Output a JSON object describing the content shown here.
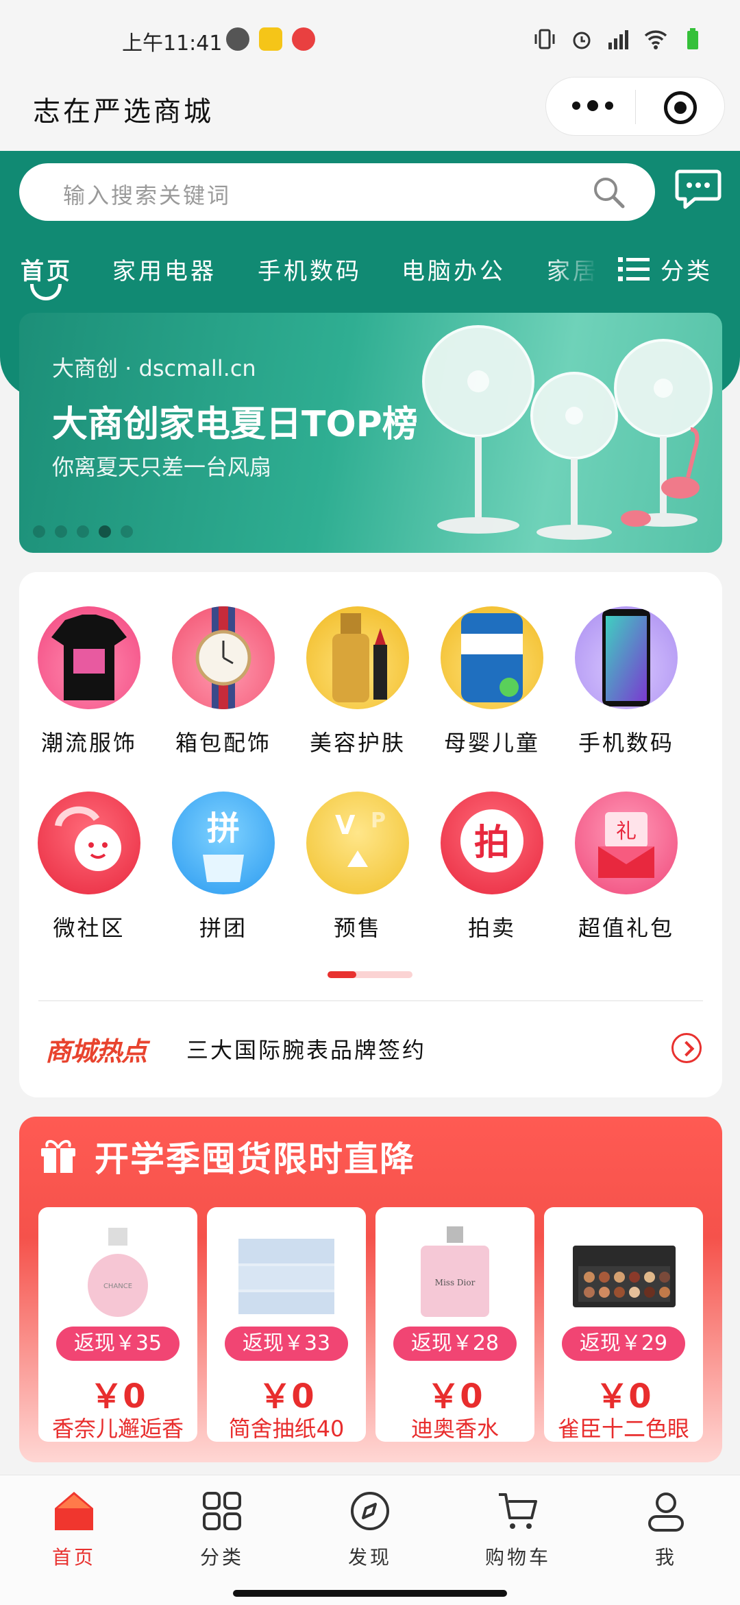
{
  "status_bar": {
    "time": "上午11:41"
  },
  "header": {
    "title": "志在严选商城"
  },
  "search": {
    "placeholder": "输入搜索关键词"
  },
  "nav_tabs": [
    "首页",
    "家用电器",
    "手机数码",
    "电脑办公",
    "家居"
  ],
  "category_button": "分类",
  "banner": {
    "brand": "大商创 · dscmall.cn",
    "title": "大商创家电夏日TOP榜",
    "subtitle": "你离夏天只差一台风扇",
    "active_slide": 4,
    "slide_count": 5
  },
  "categories": [
    {
      "label": "潮流服饰",
      "icon": "tshirt-icon"
    },
    {
      "label": "箱包配饰",
      "icon": "watch-icon"
    },
    {
      "label": "美容护肤",
      "icon": "cosmetics-icon"
    },
    {
      "label": "母婴儿童",
      "icon": "milk-powder-icon"
    },
    {
      "label": "手机数码",
      "icon": "phone-icon"
    },
    {
      "label": "微社区",
      "icon": "chat-icon"
    },
    {
      "label": "拼团",
      "icon": "group-buy-icon"
    },
    {
      "label": "预售",
      "icon": "presale-icon"
    },
    {
      "label": "拍卖",
      "icon": "auction-icon"
    },
    {
      "label": "超值礼包",
      "icon": "gift-pack-icon"
    }
  ],
  "hot": {
    "logo": "商城热点",
    "text": "三大国际腕表品牌签约"
  },
  "promo": {
    "title": "开学季囤货限时直降",
    "products": [
      {
        "cashback": "返现￥35",
        "price": "￥0",
        "name": "香奈儿邂逅香"
      },
      {
        "cashback": "返现￥33",
        "price": "￥0",
        "name": "简舍抽纸40"
      },
      {
        "cashback": "返现￥28",
        "price": "￥0",
        "name": "迪奥香水"
      },
      {
        "cashback": "返现￥29",
        "price": "￥0",
        "name": "雀臣十二色眼"
      }
    ]
  },
  "bottom_nav": [
    {
      "label": "首页",
      "icon": "home-icon",
      "active": true
    },
    {
      "label": "分类",
      "icon": "grid-icon",
      "active": false
    },
    {
      "label": "发现",
      "icon": "compass-icon",
      "active": false
    },
    {
      "label": "购物车",
      "icon": "cart-icon",
      "active": false
    },
    {
      "label": "我",
      "icon": "user-icon",
      "active": false
    }
  ],
  "colors": {
    "brand_green": "#118a73",
    "accent_red": "#e8312f",
    "cashback_pink": "#f14573"
  }
}
